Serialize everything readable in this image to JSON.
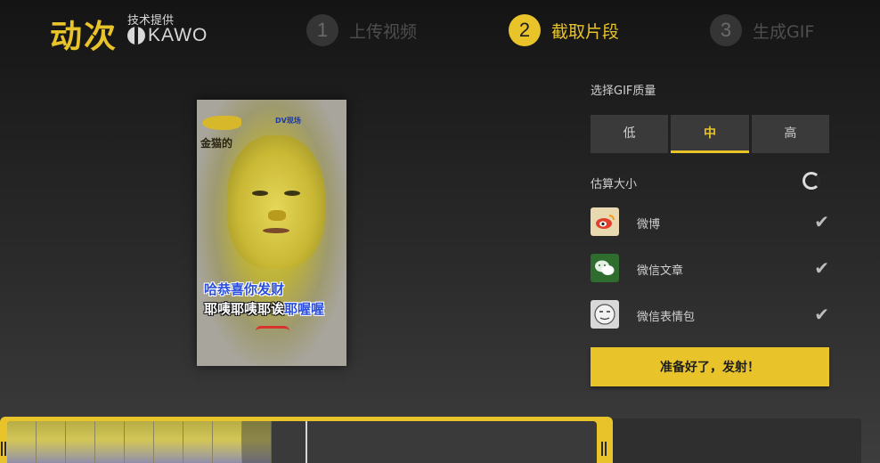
{
  "brand": {
    "logo_text": "动次",
    "tech_by": "技术提供",
    "partner": "KAWO",
    "accent_color": "#e8c32a"
  },
  "steps": [
    {
      "number": "1",
      "label": "上传视频",
      "active": false
    },
    {
      "number": "2",
      "label": "截取片段",
      "active": true
    },
    {
      "number": "3",
      "label": "生成GIF",
      "active": false
    }
  ],
  "video": {
    "corner_logo": "金猫的",
    "tv_logo": "DV现场",
    "subtitle_line1": "哈恭喜你发财",
    "subtitle_line2_white": "耶咦耶咦耶诶",
    "subtitle_line2_blue": "耶喔喔"
  },
  "quality": {
    "title": "选择GIF质量",
    "options": [
      "低",
      "中",
      "高"
    ],
    "selected": "中"
  },
  "estimate": {
    "label": "估算大小",
    "icon": "loading-spinner-icon"
  },
  "platforms": [
    {
      "label": "微博",
      "icon": "weibo-icon",
      "checked": true
    },
    {
      "label": "微信文章",
      "icon": "wechat-icon",
      "checked": true
    },
    {
      "label": "微信表情包",
      "icon": "sticker-face-icon",
      "checked": true
    }
  ],
  "actions": {
    "submit_label": "准备好了，发射！"
  },
  "timeline": {
    "frame_count": 9
  }
}
